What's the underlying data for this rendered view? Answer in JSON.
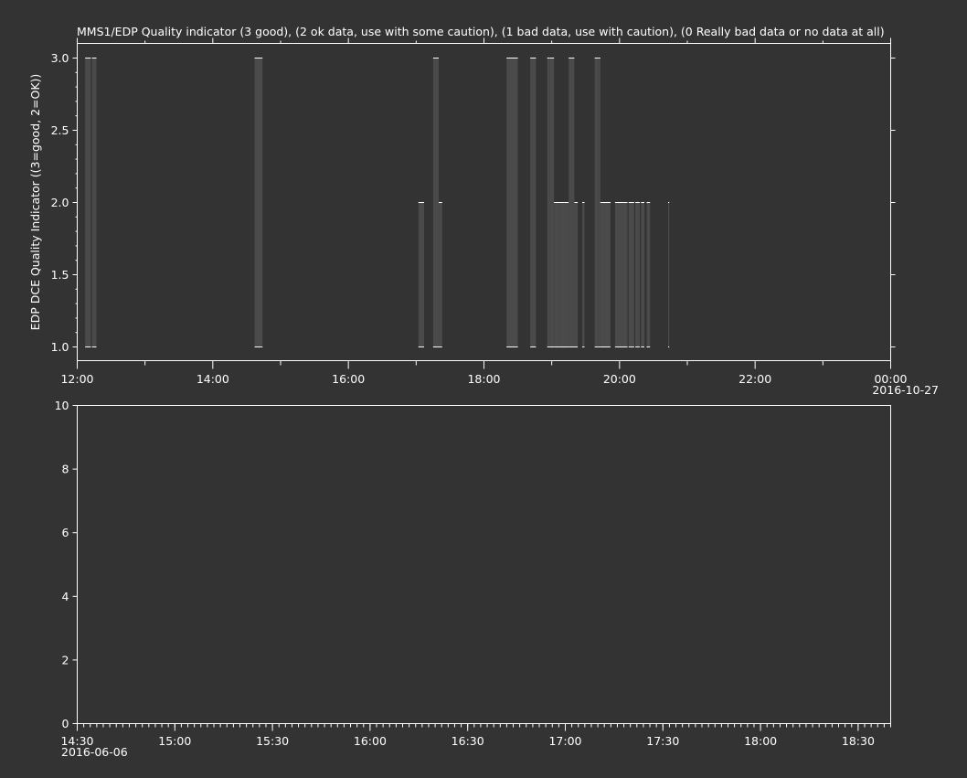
{
  "chart_data": [
    {
      "type": "bar",
      "title": "MMS1/EDP  Quality indicator (3 good), (2 ok data, use with some caution), (1 bad data, use with caution), (0 Really bad data or no data at all)",
      "ylabel": "EDP DCE Quality Indicator ((3=good, 2=OK))",
      "xlabel": "",
      "ylim": [
        0.9,
        3.1
      ],
      "y_ticks": [
        "1.0",
        "1.5",
        "2.0",
        "2.5",
        "3.0"
      ],
      "y_tick_values": [
        1.0,
        1.5,
        2.0,
        2.5,
        3.0
      ],
      "x_range_hours": [
        12,
        24
      ],
      "x_ticks": [
        "12:00",
        "14:00",
        "16:00",
        "18:00",
        "20:00",
        "22:00",
        "00:00"
      ],
      "x_tick_hours": [
        12,
        14,
        16,
        18,
        20,
        22,
        24
      ],
      "x_date_label": "2016-10-27",
      "bar_color": "#4a4a4a",
      "base_value": 1.0,
      "segments": [
        {
          "start": "12:07",
          "end": "12:12",
          "value": 3.0
        },
        {
          "start": "12:13",
          "end": "12:17",
          "value": 3.0
        },
        {
          "start": "14:37",
          "end": "14:44",
          "value": 3.0
        },
        {
          "start": "17:02",
          "end": "17:07",
          "value": 2.0
        },
        {
          "start": "17:15",
          "end": "17:20",
          "value": 3.0
        },
        {
          "start": "17:20",
          "end": "17:23",
          "value": 2.0
        },
        {
          "start": "18:20",
          "end": "18:30",
          "value": 3.0
        },
        {
          "start": "18:41",
          "end": "18:46",
          "value": 3.0
        },
        {
          "start": "18:56",
          "end": "18:58",
          "value": 3.0
        },
        {
          "start": "18:58",
          "end": "19:02",
          "value": 3.0
        },
        {
          "start": "19:02",
          "end": "19:06",
          "value": 2.0
        },
        {
          "start": "19:06",
          "end": "19:15",
          "value": 2.0
        },
        {
          "start": "19:15",
          "end": "19:20",
          "value": 3.0
        },
        {
          "start": "19:20",
          "end": "19:23",
          "value": 2.0
        },
        {
          "start": "19:27",
          "end": "19:29",
          "value": 2.0
        },
        {
          "start": "19:38",
          "end": "19:41",
          "value": 3.0
        },
        {
          "start": "19:41",
          "end": "19:43",
          "value": 3.0
        },
        {
          "start": "19:43",
          "end": "19:52",
          "value": 2.0
        },
        {
          "start": "19:56",
          "end": "20:03",
          "value": 2.0
        },
        {
          "start": "20:03",
          "end": "20:07",
          "value": 2.0
        },
        {
          "start": "20:08",
          "end": "20:13",
          "value": 2.0
        },
        {
          "start": "20:14",
          "end": "20:18",
          "value": 2.0
        },
        {
          "start": "20:19",
          "end": "20:22",
          "value": 2.0
        },
        {
          "start": "20:24",
          "end": "20:27",
          "value": 2.0
        },
        {
          "start": "20:43",
          "end": "20:44",
          "value": 2.0
        }
      ]
    },
    {
      "type": "line",
      "title": "",
      "ylabel": "",
      "xlabel": "",
      "ylim": [
        0,
        10
      ],
      "y_ticks": [
        "0",
        "2",
        "4",
        "6",
        "8",
        "10"
      ],
      "y_tick_values": [
        0,
        2,
        4,
        6,
        8,
        10
      ],
      "x_range_hours": [
        14.5,
        18.6667
      ],
      "x_ticks": [
        "14:30",
        "15:00",
        "15:30",
        "16:00",
        "16:30",
        "17:00",
        "17:30",
        "18:00",
        "18:30"
      ],
      "x_tick_hours": [
        14.5,
        15,
        15.5,
        16,
        16.5,
        17,
        17.5,
        18,
        18.5
      ],
      "x_date_label": "2016-06-06",
      "series": []
    }
  ]
}
